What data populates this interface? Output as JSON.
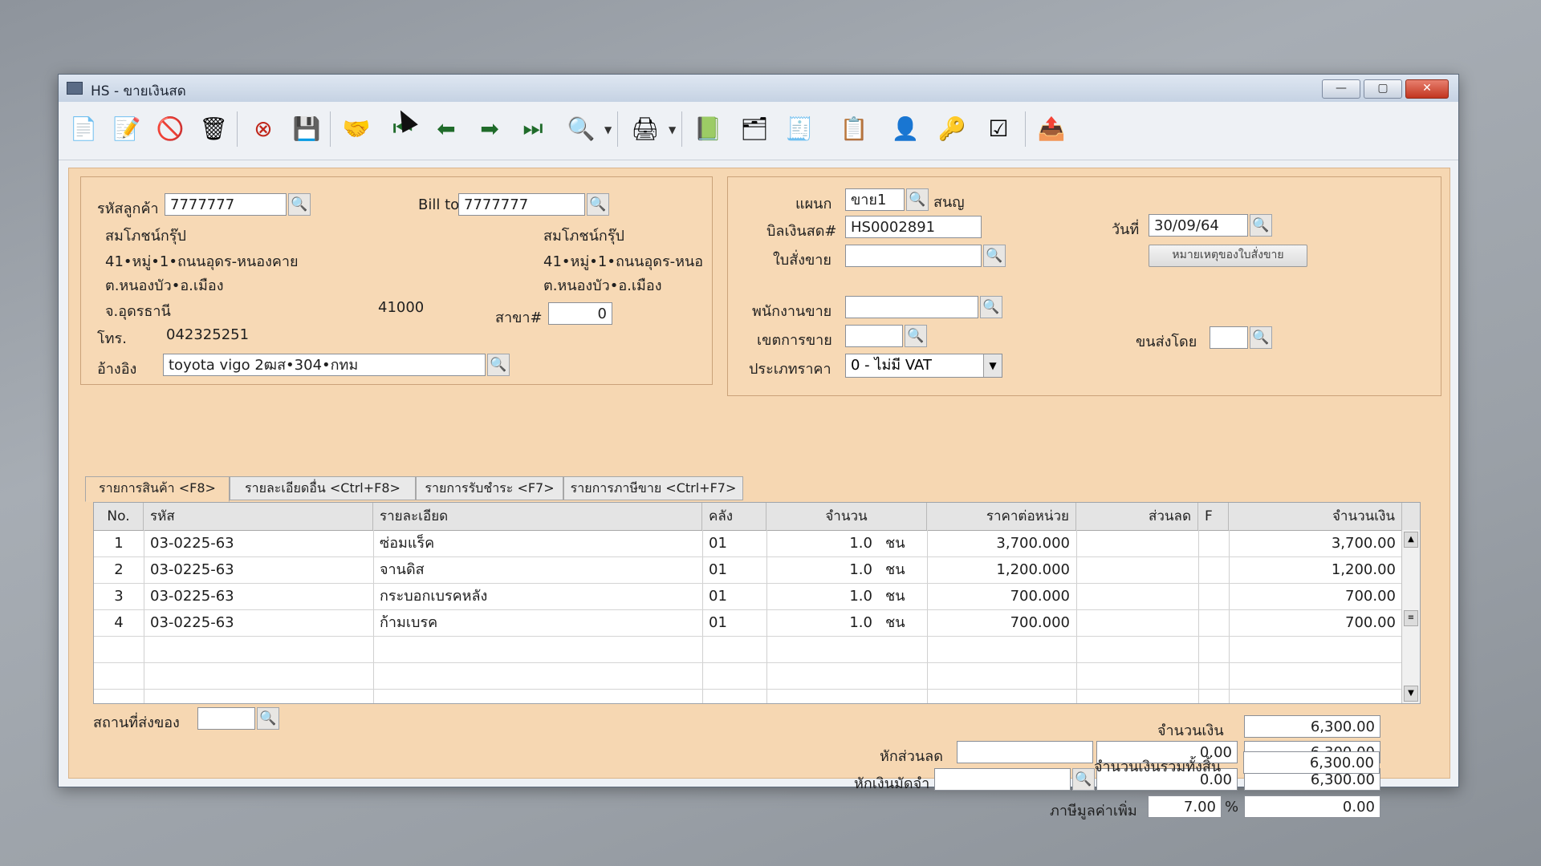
{
  "window": {
    "title": "HS - ขายเงินสด",
    "controls": {
      "min": "—",
      "max": "▢",
      "close": "✕"
    }
  },
  "toolbar": {
    "icons": [
      "new-doc-icon",
      "edit-icon",
      "void-icon",
      "trash-icon",
      "cancel-icon",
      "save-icon",
      "hand-icon",
      "first-record-icon",
      "prev-record-icon",
      "next-record-icon",
      "last-record-icon",
      "search-doc-icon",
      "printer-icon",
      "note-icon",
      "card-icon",
      "sd-icon",
      "redline-icon",
      "approve-ok-icon",
      "key-ok-icon",
      "doc-ok-icon",
      "export-icon"
    ]
  },
  "customer": {
    "code_label": "รหัสลูกค้า",
    "code": "7777777",
    "name": "สมโภชน์กรุ๊ป",
    "addr1": "41•หมู่•1•ถนนอุดร-หนองคาย",
    "addr2": "ต.หนองบัว•อ.เมือง",
    "addr3": "จ.อุดรธานี",
    "zip": "41000",
    "phone_label": "โทร.",
    "phone": "042325251",
    "ref_label": "อ้างอิง",
    "ref": "toyota vigo 2ฒส•304•กทม"
  },
  "billto": {
    "label": "Bill to",
    "code": "7777777",
    "name": "สมโภชน์กรุ๊ป",
    "addr1": "41•หมู่•1•ถนนอุดร-หนอ",
    "addr2": "ต.หนองบัว•อ.เมือง",
    "branch_label": "สาขา#",
    "branch": "0"
  },
  "doc": {
    "dept_label": "แผนก",
    "dept": "ขาย1",
    "dept_name": "สนญ",
    "bill_label": "บิลเงินสด#",
    "bill_no": "HS0002891",
    "order_label": "ใบสั่งขาย",
    "order": "",
    "date_label": "วันที่",
    "date": "30/09/64",
    "order_note_btn": "หมายเหตุของใบสั่งขาย",
    "salesman_label": "พนักงานขาย",
    "salesman": "",
    "area_label": "เขตการขาย",
    "area": "",
    "ship_by_label": "ขนส่งโดย",
    "ship_by": "",
    "price_type_label": "ประเภทราคา",
    "price_type": "0 - ไม่มี VAT"
  },
  "tabs": [
    {
      "label": "รายการสินค้า <F8>"
    },
    {
      "label": "รายละเอียดอื่น <Ctrl+F8>"
    },
    {
      "label": "รายการรับชำระ <F7>"
    },
    {
      "label": "รายการภาษีขาย <Ctrl+F7>"
    }
  ],
  "grid": {
    "headers": {
      "no": "No.",
      "code": "รหัส",
      "desc": "รายละเอียด",
      "wh": "คลัง",
      "qty": "จำนวน",
      "price": "ราคาต่อหน่วย",
      "disc": "ส่วนลด",
      "f": "F",
      "amount": "จำนวนเงิน"
    },
    "rows": [
      {
        "no": "1",
        "code": "03-0225-63",
        "desc": "ซ่อมแร็ค",
        "wh": "01",
        "qty": "1.0",
        "unit": "ชน",
        "price": "3,700.000",
        "disc": "",
        "f": "",
        "amount": "3,700.00"
      },
      {
        "no": "2",
        "code": "03-0225-63",
        "desc": "จานดิส",
        "wh": "01",
        "qty": "1.0",
        "unit": "ชน",
        "price": "1,200.000",
        "disc": "",
        "f": "",
        "amount": "1,200.00"
      },
      {
        "no": "3",
        "code": "03-0225-63",
        "desc": "กระบอกเบรคหลัง",
        "wh": "01",
        "qty": "1.0",
        "unit": "ชน",
        "price": "700.000",
        "disc": "",
        "f": "",
        "amount": "700.00"
      },
      {
        "no": "4",
        "code": "03-0225-63",
        "desc": "ก้ามเบรค",
        "wh": "01",
        "qty": "1.0",
        "unit": "ชน",
        "price": "700.000",
        "disc": "",
        "f": "",
        "amount": "700.00"
      }
    ]
  },
  "footer": {
    "ship_place_label": "สถานที่ส่งของ",
    "ship_place": "",
    "amount_label": "จำนวนเงิน",
    "amount": "6,300.00",
    "discount_label": "หักส่วนลด",
    "discount_text": "",
    "discount_value": "0.00",
    "after_discount": "6,300.00",
    "deposit_label": "หักเงินมัดจำ",
    "deposit_text": "",
    "deposit_value": "0.00",
    "after_deposit": "6,300.00",
    "vat_label": "ภาษีมูลค่าเพิ่ม",
    "vat_rate": "7.00",
    "vat_pct": "%",
    "vat_amount": "0.00",
    "total_label": "จำนวนเงินรวมทั้งสิ้น",
    "total": "6,300.00"
  }
}
